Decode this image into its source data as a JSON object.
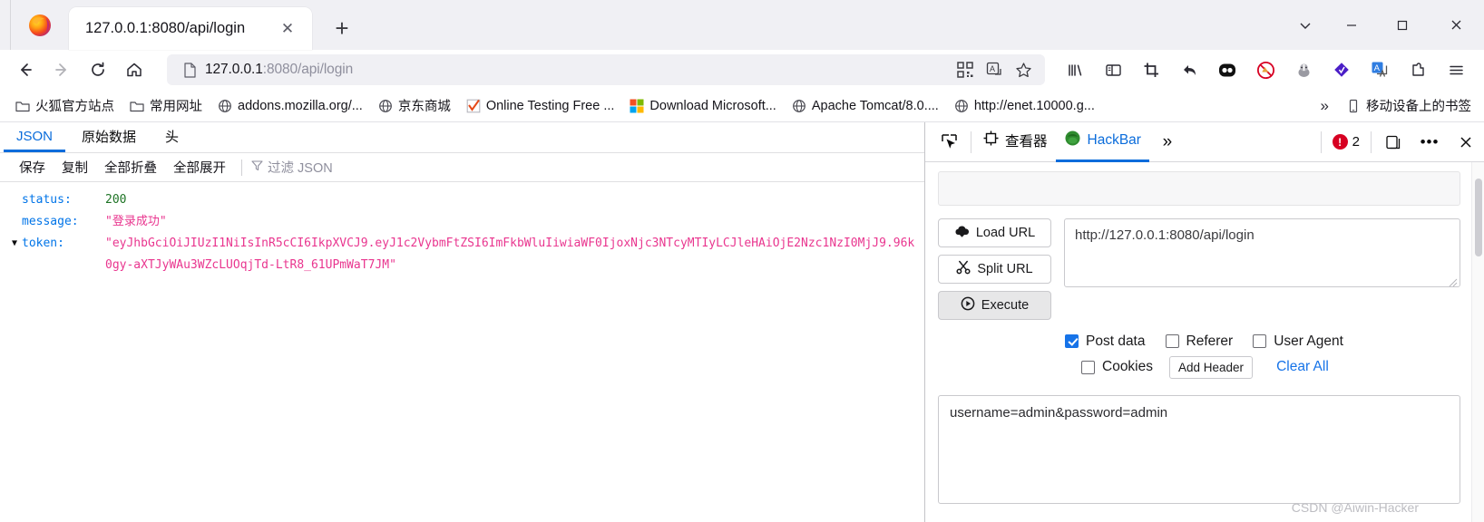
{
  "window": {
    "minimize_label": "—",
    "maximize_label": "□",
    "close_label": "✕",
    "list_all_tabs_label": "⌄"
  },
  "tabstrip": {
    "tabs": [
      {
        "title": "127.0.0.1:8080/api/login",
        "close_label": "✕"
      }
    ],
    "new_tab_label": "+"
  },
  "navbar": {
    "back_label": "←",
    "forward_label": "→",
    "reload_label": "⟳",
    "home_label": "⌂",
    "url_host": "127.0.0.1",
    "url_rest": ":8080/api/login",
    "url_full": "127.0.0.1:8080/api/login",
    "qr_icon": "qr-code-icon",
    "translate_icon": "translate-icon",
    "bookmark_icon": "star-icon",
    "toolbar_icons": [
      "library-icon",
      "sidebar-icon",
      "screenshot-crop-icon",
      "undo-arrow-icon",
      "cookie-manager-icon",
      "adblock-icon",
      "privacy-badger-icon",
      "wappalyzer-icon",
      "translate-extension-icon",
      "extensions-puzzle-icon",
      "app-menu-icon"
    ]
  },
  "bookmarks": {
    "items": [
      {
        "label": "火狐官方站点",
        "icon": "folder-icon"
      },
      {
        "label": "常用网址",
        "icon": "folder-icon"
      },
      {
        "label": "addons.mozilla.org/...",
        "icon": "globe-icon"
      },
      {
        "label": "京东商城",
        "icon": "globe-icon"
      },
      {
        "label": "Online Testing Free ...",
        "icon": "checkmark-icon"
      },
      {
        "label": "Download Microsoft...",
        "icon": "microsoft-icon"
      },
      {
        "label": "Apache Tomcat/8.0....",
        "icon": "globe-icon"
      },
      {
        "label": "http://enet.10000.g...",
        "icon": "globe-icon"
      }
    ],
    "overflow_label": "»",
    "mobile_bookmarks": {
      "label": "移动设备上的书签",
      "icon": "mobile-icon"
    }
  },
  "json_viewer": {
    "tabs": [
      {
        "label": "JSON",
        "active": true
      },
      {
        "label": "原始数据",
        "active": false
      },
      {
        "label": "头",
        "active": false
      }
    ],
    "toolbar": {
      "save": "保存",
      "copy": "复制",
      "collapse_all": "全部折叠",
      "expand_all": "全部展开",
      "filter_placeholder": "过滤 JSON",
      "filter_icon": "funnel-icon"
    },
    "rows": [
      {
        "key": "status:",
        "value": "200",
        "kind": "num",
        "twisty": ""
      },
      {
        "key": "message:",
        "value": "\"登录成功\"",
        "kind": "str",
        "twisty": ""
      },
      {
        "key": "token:",
        "value": "\"eyJhbGciOiJIUzI1NiIsInR5cCI6IkpXVCJ9.eyJ1c2VybmFtZSI6ImFkbWluIiwiaWF0IjoxNjc3NTcyMTIyLCJleHAiOjE2Nzc1NzI0MjJ9.96k0gy-aXTJyWAu3WZcLUOqjTd-LtR8_61UPmWaT7JM\"",
        "kind": "tok",
        "twisty": "▼"
      }
    ]
  },
  "devtools": {
    "toolbar": {
      "picker_icon": "element-picker-icon",
      "responsive_icon": "responsive-design-icon",
      "inspector_label": "查看器",
      "inspector_icon": "inspector-box-icon",
      "hackbar_label": "HackBar",
      "hackbar_icon": "hackbar-logo-icon",
      "more_tabs_label": "»",
      "error_count": "2",
      "error_icon": "error-circle-icon",
      "dock_icon": "dock-to-side-icon",
      "meatball_label": "•••",
      "close_label": "✕"
    },
    "hackbar": {
      "load_url_label": "Load URL",
      "load_url_icon": "cloud-download-icon",
      "split_url_label": "Split URL",
      "split_url_icon": "scissors-icon",
      "execute_label": "Execute",
      "execute_icon": "play-circle-icon",
      "url_value": "http://127.0.0.1:8080/api/login",
      "options": [
        {
          "label": "Post data",
          "checked": true
        },
        {
          "label": "Referer",
          "checked": false
        },
        {
          "label": "User Agent",
          "checked": false
        }
      ],
      "cookies": {
        "label": "Cookies",
        "checked": false
      },
      "add_header_label": "Add Header",
      "clear_all_label": "Clear All",
      "post_data_value": "username=admin&password=admin"
    }
  },
  "watermark": "CSDN @Aiwin-Hacker"
}
